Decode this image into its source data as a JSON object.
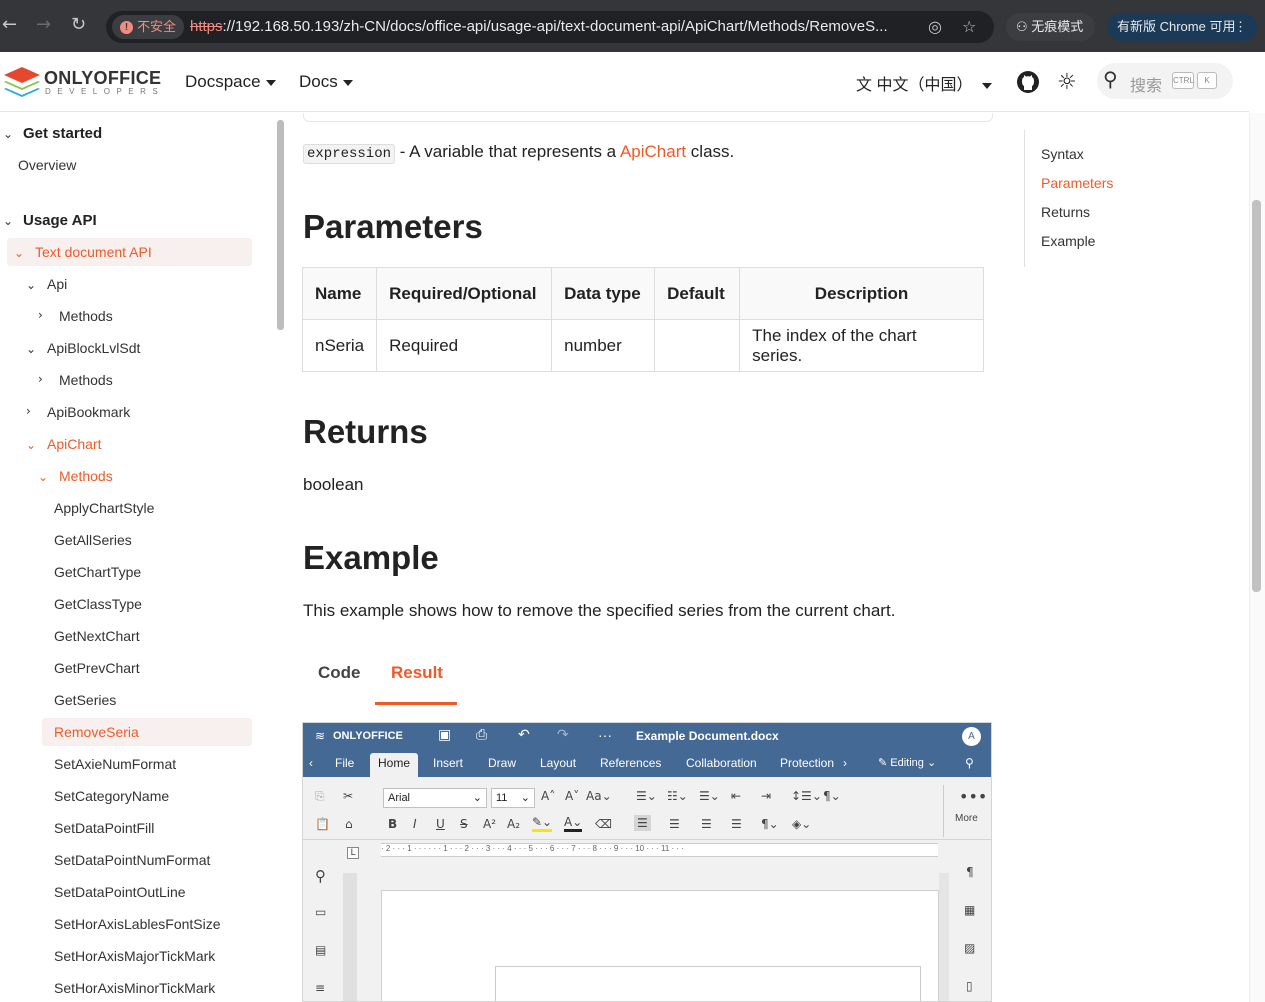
{
  "browser": {
    "security_label": "不安全",
    "url_scheme": "https",
    "url_rest": "://192.168.50.193/zh-CN/docs/office-api/usage-api/text-document-api/ApiChart/Methods/RemoveS...",
    "incognito_label": "无痕模式",
    "update_label": "有新版 Chrome 可用"
  },
  "header": {
    "logo_text": "ONLYOFFICE",
    "logo_sub": "DEVELOPERS",
    "nav": [
      "Docspace",
      "Docs"
    ],
    "language": "中文（中国）",
    "search_placeholder": "搜索",
    "kbd_ctrl": "CTRL",
    "kbd_k": "K"
  },
  "sidebar": {
    "items": [
      {
        "label": "Get started"
      },
      {
        "label": "Overview"
      },
      {
        "label": "Usage API"
      },
      {
        "label": "Text document API"
      },
      {
        "label": "Api"
      },
      {
        "label": "Methods"
      },
      {
        "label": "ApiBlockLvlSdt"
      },
      {
        "label": "Methods"
      },
      {
        "label": "ApiBookmark"
      },
      {
        "label": "ApiChart"
      },
      {
        "label": "Methods"
      },
      {
        "label": "ApplyChartStyle"
      },
      {
        "label": "GetAllSeries"
      },
      {
        "label": "GetChartType"
      },
      {
        "label": "GetClassType"
      },
      {
        "label": "GetNextChart"
      },
      {
        "label": "GetPrevChart"
      },
      {
        "label": "GetSeries"
      },
      {
        "label": "RemoveSeria"
      },
      {
        "label": "SetAxieNumFormat"
      },
      {
        "label": "SetCategoryName"
      },
      {
        "label": "SetDataPointFill"
      },
      {
        "label": "SetDataPointNumFormat"
      },
      {
        "label": "SetDataPointOutLine"
      },
      {
        "label": "SetHorAxisLablesFontSize"
      },
      {
        "label": "SetHorAxisMajorTickMark"
      },
      {
        "label": "SetHorAxisMinorTickMark"
      }
    ]
  },
  "main": {
    "expression_code": "expression",
    "expression_text_before": " - A variable that represents a ",
    "expression_link": "ApiChart",
    "expression_text_after": " class.",
    "parameters_heading": "Parameters",
    "table_headers": [
      "Name",
      "Required/Optional",
      "Data type",
      "Default",
      "Description"
    ],
    "table_row": [
      "nSeria",
      "Required",
      "number",
      "",
      "The index of the chart series."
    ],
    "returns_heading": "Returns",
    "returns_value": "boolean",
    "example_heading": "Example",
    "example_text": "This example shows how to remove the specified series from the current chart.",
    "tabs": [
      "Code",
      "Result"
    ]
  },
  "editor": {
    "brand": "ONLYOFFICE",
    "doc_title": "Example Document.docx",
    "avatar": "A",
    "tabs": [
      "File",
      "Home",
      "Insert",
      "Draw",
      "Layout",
      "References",
      "Collaboration",
      "Protection"
    ],
    "editing_label": "Editing",
    "font_name": "Arial",
    "font_size": "11",
    "more_label": "More",
    "ruler_text": "· 2 · · · 1 · · ·   · · · 1 · · · 2 · · · 3 · · · 4 · · · 5 · · · 6 · · · 7 · · · 8 · · · 9 · · · 10 · · · 11 · · ·"
  },
  "toc": {
    "items": [
      "Syntax",
      "Parameters",
      "Returns",
      "Example"
    ]
  }
}
